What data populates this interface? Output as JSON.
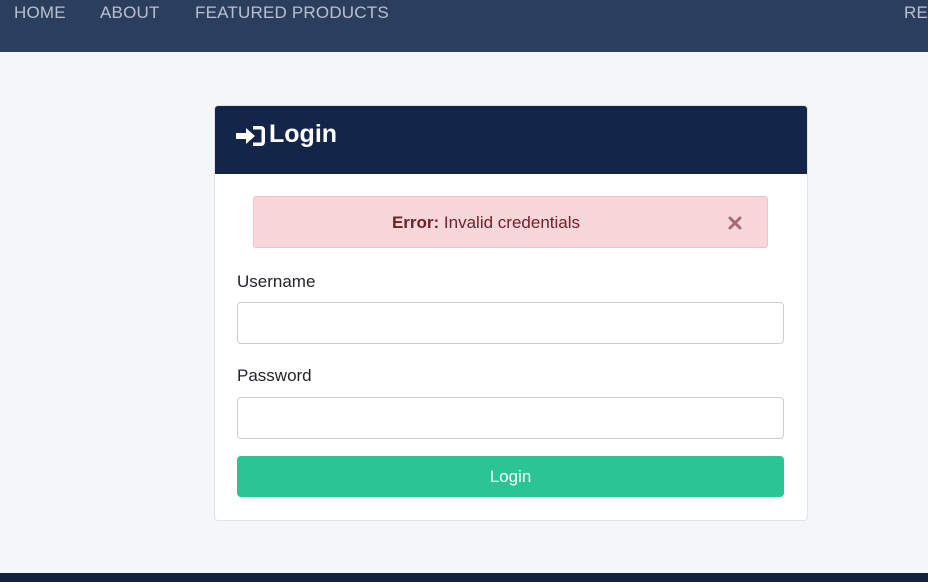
{
  "nav": {
    "items": [
      {
        "label": "HOME"
      },
      {
        "label": "ABOUT"
      },
      {
        "label": "FEATURED PRODUCTS"
      },
      {
        "label": "REG"
      }
    ]
  },
  "login_card": {
    "title": "Login",
    "icon": "sign-in-icon",
    "alert": {
      "prefix": "Error:",
      "message": " Invalid credentials",
      "close_icon": "close-icon"
    },
    "username_label": "Username",
    "username_value": "",
    "password_label": "Password",
    "password_value": "",
    "submit_label": "Login"
  },
  "colors": {
    "nav_bg": "#2c3e5e",
    "card_header_bg": "#13264a",
    "alert_bg": "#f8d7da",
    "alert_text": "#722028",
    "button_bg": "#2bc594"
  }
}
